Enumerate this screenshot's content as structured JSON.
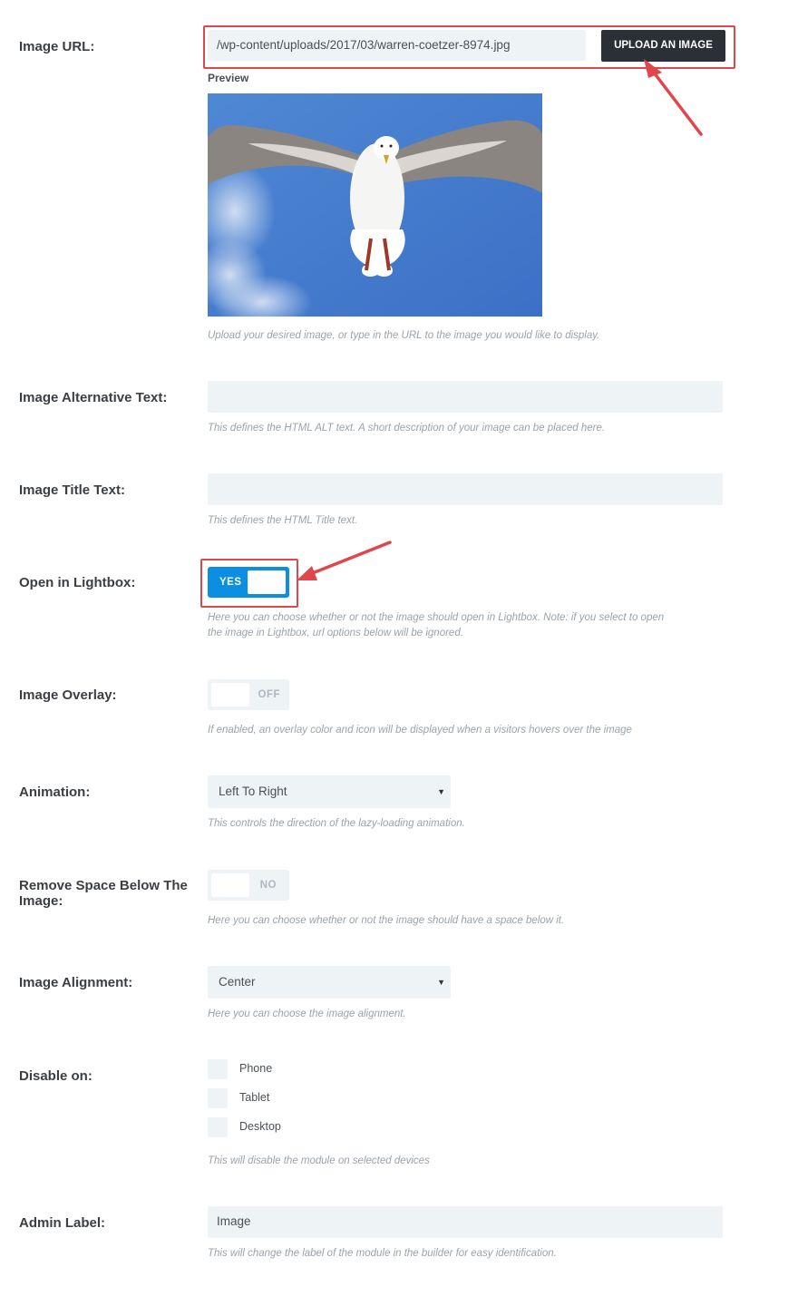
{
  "image_url": {
    "label": "Image URL:",
    "value": "/wp-content/uploads/2017/03/warren-coetzer-8974.jpg",
    "upload_button": "UPLOAD AN IMAGE",
    "preview_label": "Preview",
    "hint": "Upload your desired image, or type in the URL to the image you would like to display."
  },
  "alt_text": {
    "label": "Image Alternative Text:",
    "value": "",
    "hint": "This defines the HTML ALT text. A short description of your image can be placed here."
  },
  "title_text": {
    "label": "Image Title Text:",
    "value": "",
    "hint": "This defines the HTML Title text."
  },
  "lightbox": {
    "label": "Open in Lightbox:",
    "state": "YES",
    "hint_line1": "Here you can choose whether or not the image should open in Lightbox. Note: if you select to open",
    "hint_line2": "the image in Lightbox, url options below will be ignored."
  },
  "overlay": {
    "label": "Image Overlay:",
    "state": "OFF",
    "hint": "If enabled, an overlay color and icon will be displayed when a visitors hovers over the image"
  },
  "animation": {
    "label": "Animation:",
    "value": "Left To Right",
    "hint": "This controls the direction of the lazy-loading animation."
  },
  "remove_space": {
    "label_line1": "Remove Space Below The",
    "label_line2": "Image:",
    "state": "NO",
    "hint": "Here you can choose whether or not the image should have a space below it."
  },
  "alignment": {
    "label": "Image Alignment:",
    "value": "Center",
    "hint": "Here you can choose the image alignment."
  },
  "disable_on": {
    "label": "Disable on:",
    "options": [
      "Phone",
      "Tablet",
      "Desktop"
    ],
    "hint": "This will disable the module on selected devices"
  },
  "admin_label": {
    "label": "Admin Label:",
    "value": "Image",
    "hint": "This will change the label of the module in the builder for easy identification."
  },
  "colors": {
    "accent": "#0c8ee2",
    "highlight": "#e0474c",
    "button_dark": "#2b3036",
    "field_bg": "#eef3f6"
  },
  "icons": [
    "caret-down-icon",
    "annotation-arrow"
  ]
}
